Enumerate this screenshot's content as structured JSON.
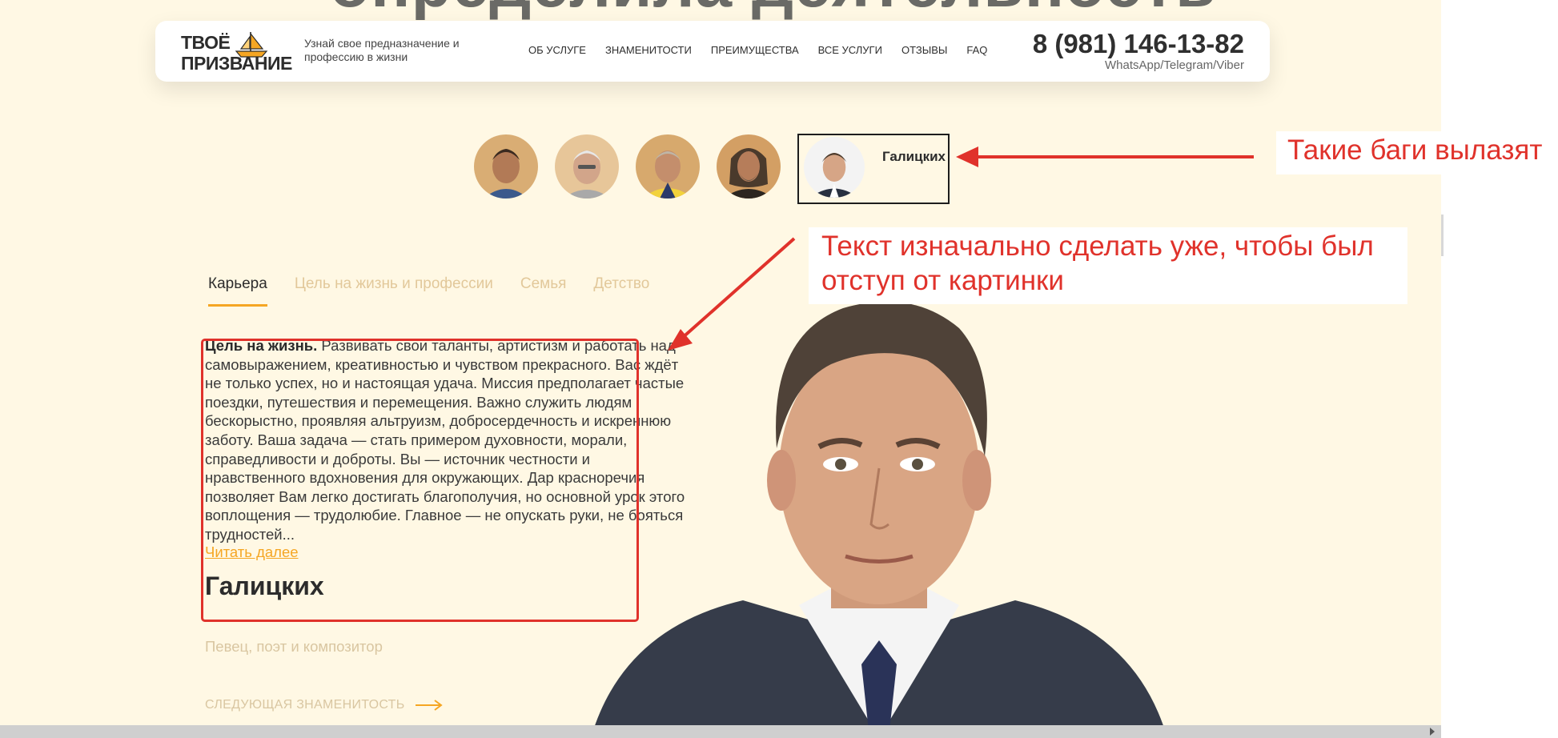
{
  "page": {
    "top_heading": "определила деятельность"
  },
  "header": {
    "logo_line1": "ТВОЁ",
    "logo_line2": "ПРИЗВАНИЕ",
    "logo_icon": "sailboat-icon",
    "tagline": "Узнай свое предназначение и профессию в жизни",
    "nav": [
      "ОБ УСЛУГЕ",
      "ЗНАМЕНИТОСТИ",
      "ПРЕИМУЩЕСТВА",
      "ВСЕ УСЛУГИ",
      "ОТЗЫВЫ",
      "FAQ"
    ],
    "phone": "8 (981) 146-13-82",
    "phone_sub": "WhatsApp/Telegram/Viber"
  },
  "celebrities": {
    "active_name": "Галицких"
  },
  "tabs": [
    "Карьера",
    "Цель на жизнь и профессии",
    "Семья",
    "Детство"
  ],
  "content": {
    "lead_label": "Цель на жизнь.",
    "text": "Развивать свои таланты, артистизм и работать над самовыражением, креативностью и чувством прекрасного. Вас ждёт не только успех, но и настоящая удача. Миссия предполагает частые поездки, путешествия и перемещения. Важно служить людям бескорыстно, проявляя альтруизм, добросердечность и искреннюю заботу. Ваша задача — стать примером духовности, морали, справедливости и доброты. Вы — источник честности и нравственного вдохновения для окружающих. Дар красноречия позволяет Вам легко достигать благополучия, но основной урок этого воплощения — трудолюбие. Главное — не опускать руки, не бояться трудностей...",
    "read_more": "Читать далее",
    "name": "Галицких",
    "role": "Певец, поэт и композитор",
    "next": "СЛЕДУЮЩАЯ ЗНАМЕНИТОСТЬ"
  },
  "annotations": {
    "bug_note": "Такие баги вылазят",
    "text_note": "Текст изначально сделать уже, чтобы был отступ от картинки"
  },
  "colors": {
    "background": "#fff8e4",
    "accent": "#f5a623",
    "annotation": "#e0322b"
  }
}
